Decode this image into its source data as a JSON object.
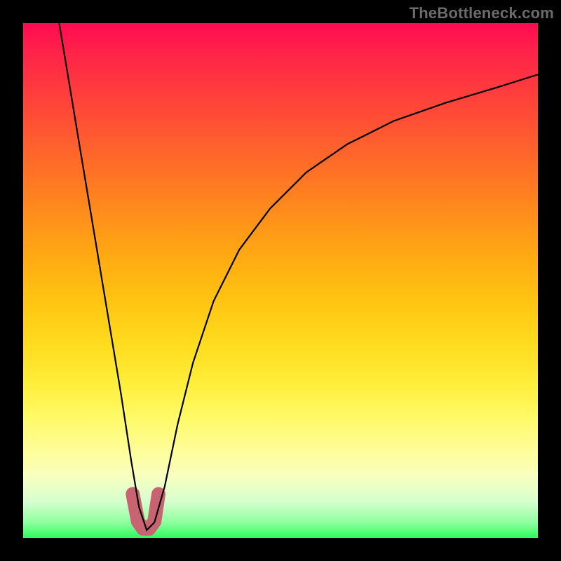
{
  "watermark": "TheBottleneck.com",
  "chart_data": {
    "type": "line",
    "title": "",
    "xlabel": "",
    "ylabel": "",
    "xlim": [
      0,
      100
    ],
    "ylim": [
      0,
      100
    ],
    "grid": false,
    "legend": false,
    "series": [
      {
        "name": "bottleneck-curve",
        "x": [
          7,
          9,
          11,
          13,
          15,
          17,
          19,
          21,
          22.5,
          24,
          25.5,
          27.5,
          30,
          33,
          37,
          42,
          48,
          55,
          63,
          72,
          82,
          92,
          100
        ],
        "values": [
          100,
          88,
          76,
          64,
          52,
          40,
          28,
          15,
          6,
          1.5,
          3,
          10,
          22,
          34,
          46,
          56,
          64,
          71,
          76.5,
          81,
          84.5,
          87.5,
          90
        ]
      },
      {
        "name": "optimal-region-marker",
        "x": [
          21.3,
          22.3,
          23.3,
          24.5,
          25.5,
          26.3
        ],
        "values": [
          8.5,
          3.2,
          1.8,
          1.8,
          3.2,
          8.5
        ]
      }
    ],
    "background_gradient": {
      "top": "#ff0b52",
      "bottom": "#2bff5c"
    }
  }
}
